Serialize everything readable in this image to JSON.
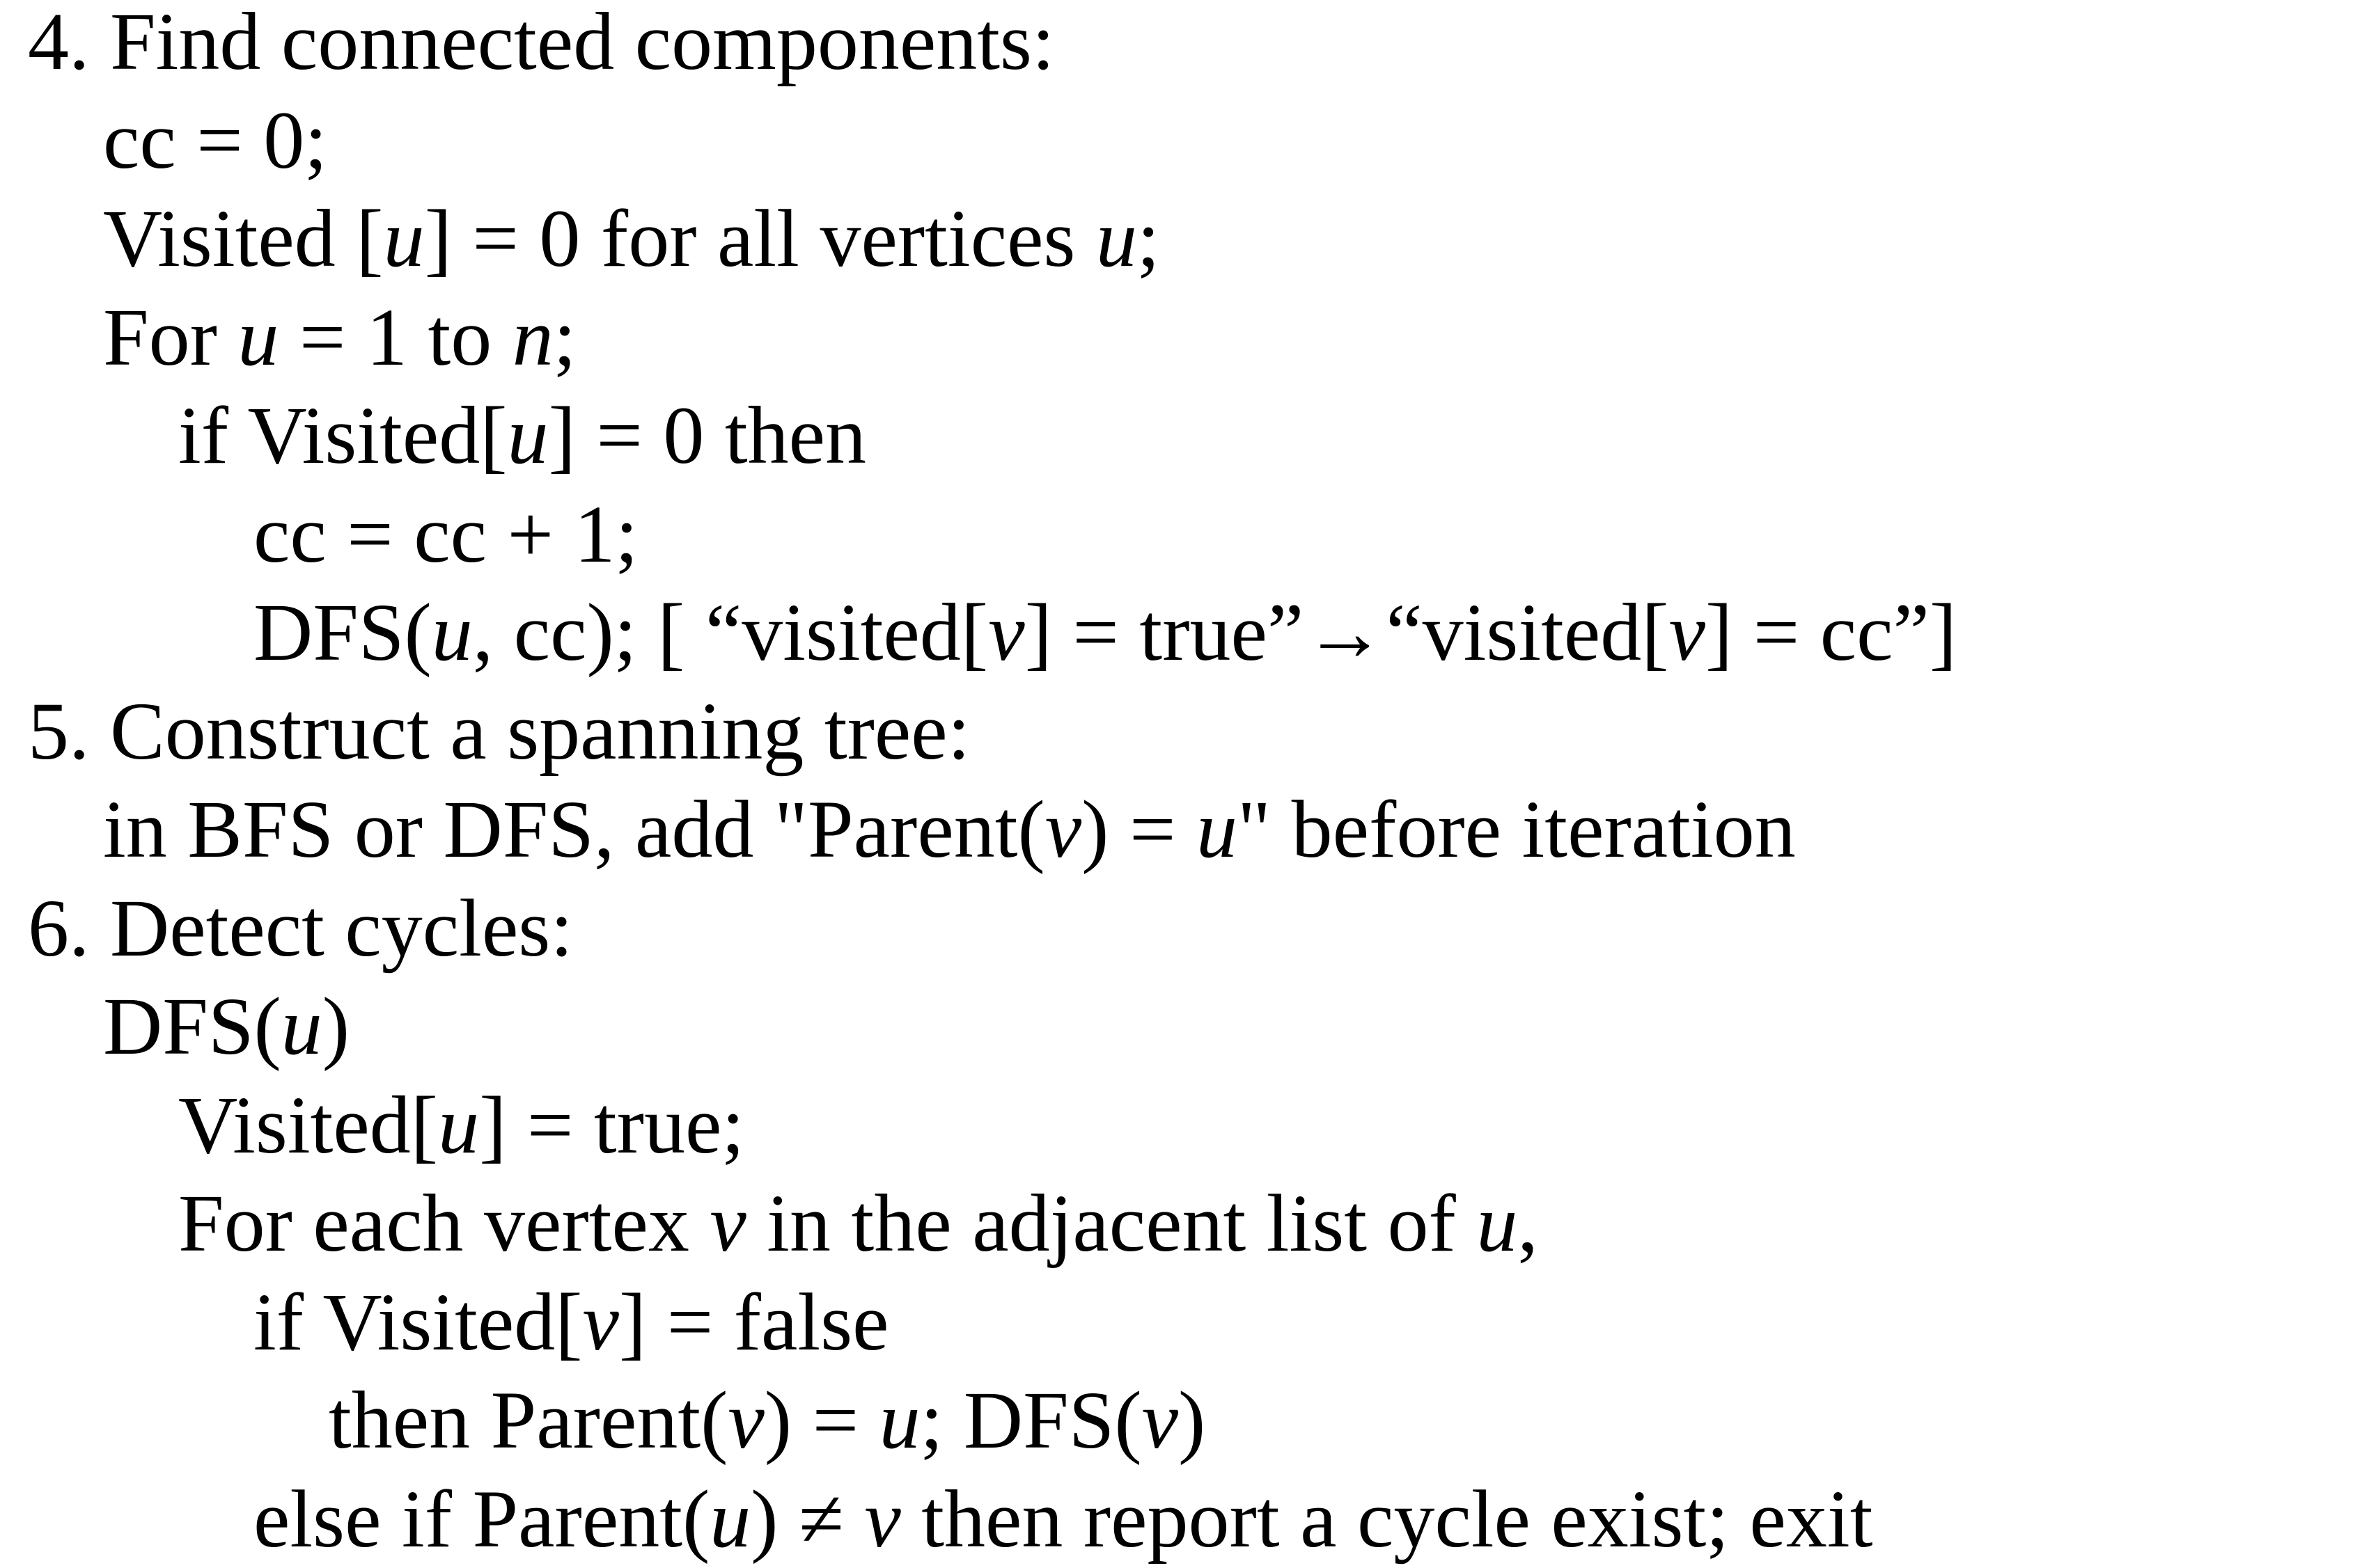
{
  "pseudocode": {
    "lines": [
      {
        "indent": 0,
        "runs": [
          {
            "t": "4. Find connected components:"
          }
        ]
      },
      {
        "indent": 1,
        "runs": [
          {
            "t": "cc = 0;"
          }
        ]
      },
      {
        "indent": 1,
        "runs": [
          {
            "t": "Visited ["
          },
          {
            "t": "u",
            "i": true
          },
          {
            "t": "] = 0 for all vertices "
          },
          {
            "t": "u",
            "i": true
          },
          {
            "t": ";"
          }
        ]
      },
      {
        "indent": 1,
        "runs": [
          {
            "t": "For "
          },
          {
            "t": "u",
            "i": true
          },
          {
            "t": " = 1 to "
          },
          {
            "t": "n",
            "i": true
          },
          {
            "t": ";"
          }
        ]
      },
      {
        "indent": 2,
        "runs": [
          {
            "t": "if Visited["
          },
          {
            "t": "u",
            "i": true
          },
          {
            "t": "] = 0 then"
          }
        ]
      },
      {
        "indent": 3,
        "runs": [
          {
            "t": "cc = cc + 1;"
          }
        ]
      },
      {
        "indent": 3,
        "runs": [
          {
            "t": "DFS("
          },
          {
            "t": "u",
            "i": true
          },
          {
            "t": ", cc); [ “visited["
          },
          {
            "t": "v",
            "i": true
          },
          {
            "t": "] = true”→“visited["
          },
          {
            "t": "v",
            "i": true
          },
          {
            "t": "] = cc”]"
          }
        ]
      },
      {
        "indent": 0,
        "runs": [
          {
            "t": "5. Construct a spanning tree:"
          }
        ]
      },
      {
        "indent": 1,
        "runs": [
          {
            "t": "in BFS or DFS, add \"Parent("
          },
          {
            "t": "v",
            "i": true
          },
          {
            "t": ") = "
          },
          {
            "t": "u",
            "i": true
          },
          {
            "t": "\" before iteration"
          }
        ]
      },
      {
        "indent": 0,
        "runs": [
          {
            "t": "6. Detect cycles:"
          }
        ]
      },
      {
        "indent": 1,
        "runs": [
          {
            "t": "DFS("
          },
          {
            "t": "u",
            "i": true
          },
          {
            "t": ")"
          }
        ]
      },
      {
        "indent": 2,
        "runs": [
          {
            "t": "Visited["
          },
          {
            "t": "u",
            "i": true
          },
          {
            "t": "] = true;"
          }
        ]
      },
      {
        "indent": 2,
        "runs": [
          {
            "t": "For each vertex "
          },
          {
            "t": "v",
            "i": true
          },
          {
            "t": " in the adjacent list of "
          },
          {
            "t": "u",
            "i": true
          },
          {
            "t": ","
          }
        ]
      },
      {
        "indent": 3,
        "runs": [
          {
            "t": "if Visited["
          },
          {
            "t": "v",
            "i": true
          },
          {
            "t": "] = false"
          }
        ]
      },
      {
        "indent": 4,
        "runs": [
          {
            "t": "then Parent("
          },
          {
            "t": "v",
            "i": true
          },
          {
            "t": ") = "
          },
          {
            "t": "u",
            "i": true
          },
          {
            "t": "; DFS("
          },
          {
            "t": "v",
            "i": true
          },
          {
            "t": ")"
          }
        ]
      },
      {
        "indent": 3,
        "runs": [
          {
            "t": "else if Parent("
          },
          {
            "t": "u",
            "i": true
          },
          {
            "t": ") ≠ "
          },
          {
            "t": "v",
            "i": true
          },
          {
            "t": " then report a cycle exist; exit"
          }
        ]
      }
    ]
  }
}
